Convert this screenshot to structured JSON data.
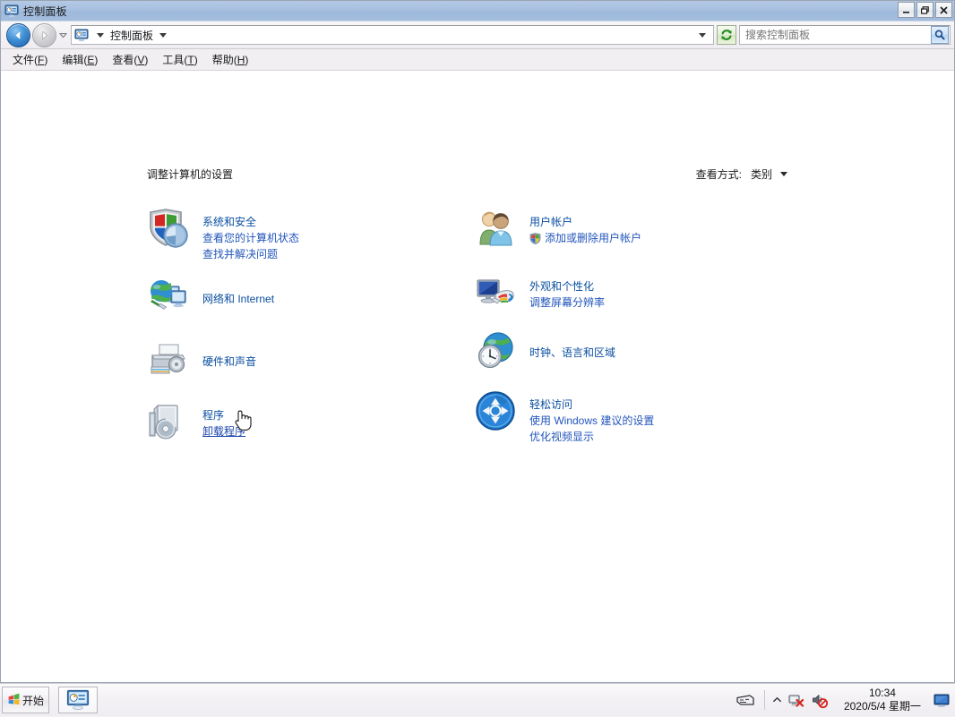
{
  "window": {
    "title": "控制面板",
    "title_icon": "control-panel-icon",
    "buttons": {
      "minimize": "minimize-icon",
      "restore": "restore-icon",
      "close": "close-icon"
    }
  },
  "navbar": {
    "back": "back-arrow-icon",
    "forward": "forward-arrow-icon",
    "history": "recent-pages-icon",
    "breadcrumb_icon": "control-panel-icon",
    "breadcrumb": "控制面板",
    "refresh": "refresh-icon",
    "dropdown": "address-dropdown-icon"
  },
  "search": {
    "placeholder": "搜索控制面板",
    "value": "",
    "icon": "search-icon"
  },
  "menubar": {
    "items": [
      {
        "pre": "文件(",
        "key": "F",
        "post": ")"
      },
      {
        "pre": "编辑(",
        "key": "E",
        "post": ")"
      },
      {
        "pre": "查看(",
        "key": "V",
        "post": ")"
      },
      {
        "pre": "工具(",
        "key": "T",
        "post": ")"
      },
      {
        "pre": "帮助(",
        "key": "H",
        "post": ")"
      }
    ]
  },
  "main": {
    "page_title": "调整计算机的设置",
    "view_by_label": "查看方式:",
    "view_by_value": "类别",
    "left_categories": [
      {
        "icon": "security-shield-icon",
        "title": "系统和安全",
        "links": [
          "查看您的计算机状态",
          "查找并解决问题"
        ]
      },
      {
        "icon": "network-globe-icon",
        "title": "网络和 Internet",
        "links": []
      },
      {
        "icon": "printer-hardware-icon",
        "title": "硬件和声音",
        "links": []
      },
      {
        "icon": "programs-disc-icon",
        "title": "程序",
        "links": [
          "卸载程序"
        ],
        "hovered_link": "卸载程序"
      }
    ],
    "right_categories": [
      {
        "icon": "user-accounts-icon",
        "title": "用户帐户",
        "links": [
          "添加或删除用户帐户"
        ],
        "shield_link": "添加或删除用户帐户"
      },
      {
        "icon": "appearance-monitor-icon",
        "title": "外观和个性化",
        "links": [
          "调整屏幕分辨率"
        ]
      },
      {
        "icon": "clock-globe-icon",
        "title": "时钟、语言和区域",
        "links": []
      },
      {
        "icon": "ease-of-access-icon",
        "title": "轻松访问",
        "links": [
          "使用 Windows 建议的设置",
          "优化视频显示"
        ]
      }
    ],
    "cursor": "hand-pointer-cursor"
  },
  "taskbar": {
    "start_label": "开始",
    "start_icon": "windows-orb-icon",
    "task_icon": "control-panel-icon",
    "tray": {
      "ime_icon": "ime-keyboard-icon",
      "chevron": "show-hidden-icons-chevron",
      "network_icon": "network-disconnected-icon",
      "volume_icon": "volume-muted-icon",
      "show_desktop": "show-desktop-icon"
    },
    "clock": {
      "time": "10:34",
      "date": "2020/5/4 星期一"
    }
  },
  "colors": {
    "titlebar": "#a3bddd",
    "link": "#2255bb",
    "title_link": "#0a4fa0",
    "window_bg": "#f1eff2",
    "content_bg": "#ffffff",
    "taskbar_bg": "#f4f2f5"
  }
}
